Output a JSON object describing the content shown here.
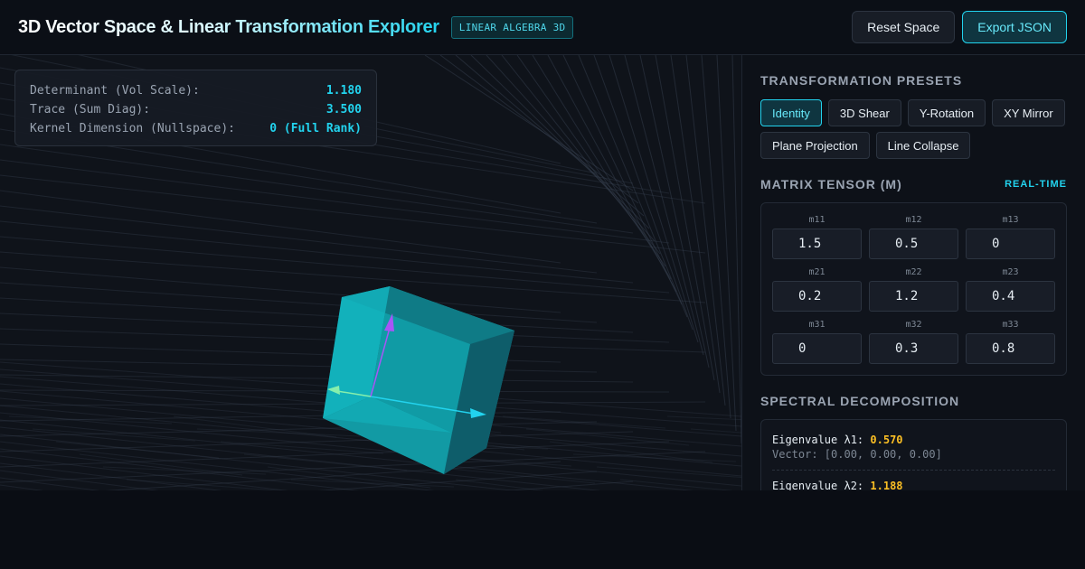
{
  "header": {
    "title": "3D Vector Space & Linear Transformation Explorer",
    "badge": "LINEAR ALGEBRA 3D",
    "reset_label": "Reset Space",
    "export_label": "Export JSON"
  },
  "stats": {
    "determinant_label": "Determinant (Vol Scale):",
    "determinant_value": "1.180",
    "trace_label": "Trace (Sum Diag):",
    "trace_value": "3.500",
    "kernel_label": "Kernel Dimension (Nullspace):",
    "kernel_value": "0 (Full Rank)"
  },
  "presets": {
    "title": "TRANSFORMATION PRESETS",
    "items": [
      "Identity",
      "3D Shear",
      "Y-Rotation",
      "XY Mirror",
      "Plane Projection",
      "Line Collapse"
    ],
    "active": "Identity"
  },
  "matrix": {
    "title": "MATRIX TENSOR (M)",
    "realtime": "REAL-TIME",
    "cells": [
      {
        "label": "m11",
        "value": "1.5"
      },
      {
        "label": "m12",
        "value": "0.5"
      },
      {
        "label": "m13",
        "value": "0"
      },
      {
        "label": "m21",
        "value": "0.2"
      },
      {
        "label": "m22",
        "value": "1.2"
      },
      {
        "label": "m23",
        "value": "0.4"
      },
      {
        "label": "m31",
        "value": "0"
      },
      {
        "label": "m32",
        "value": "0.3"
      },
      {
        "label": "m33",
        "value": "0.8"
      }
    ]
  },
  "spectral": {
    "title": "SPECTRAL DECOMPOSITION",
    "eigen": [
      {
        "label": "Eigenvalue λ1:",
        "value": "0.570",
        "vector": "Vector: [0.00, 0.00, 0.00]"
      },
      {
        "label": "Eigenvalue λ2:",
        "value": "1.188"
      }
    ]
  },
  "colors": {
    "accent": "#22d3ee",
    "eigenvalue": "#fbbf24",
    "cube": "#14b8c4",
    "vector_x": "#22d3ee",
    "vector_y": "#a855f7",
    "vector_z": "#86efac"
  },
  "icons": {
    "vector_x": "arrow-cyan",
    "vector_y": "arrow-purple",
    "vector_z": "arrow-green"
  }
}
